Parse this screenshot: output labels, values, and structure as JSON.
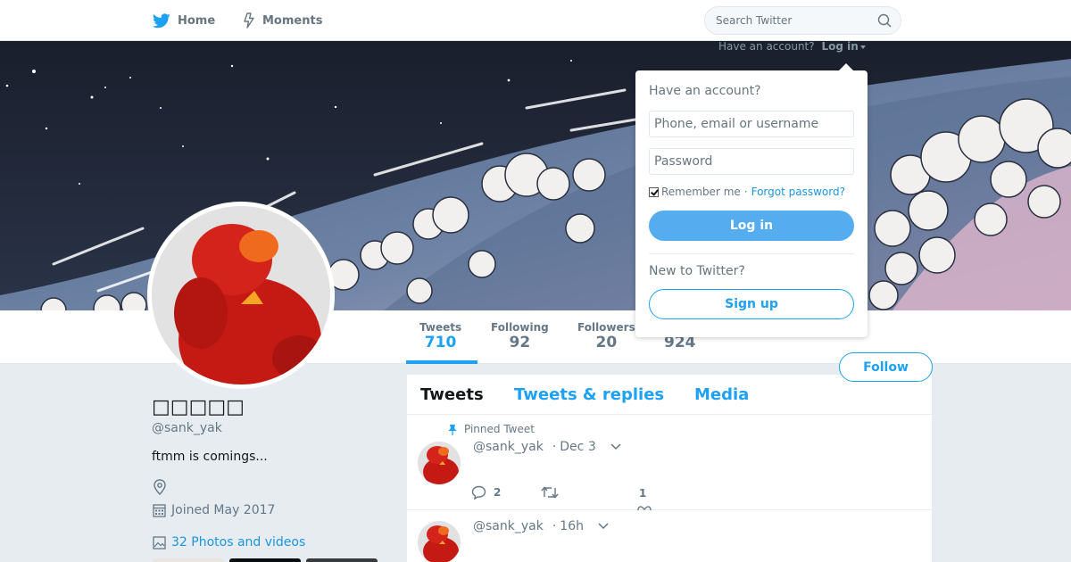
{
  "nav": {
    "home_label": "Home",
    "moments_label": "Moments",
    "search_placeholder": "Search Twitter"
  },
  "login_prompt": {
    "text": "Have an account?",
    "link": "Log in"
  },
  "profile": {
    "display_name": "□□□□□",
    "handle": "@sank_yak",
    "bio": "ftmm is comings...",
    "joined": "Joined May 2017",
    "photos_link": "32 Photos and videos"
  },
  "stats": {
    "tweets_label": "Tweets",
    "tweets_value": "710",
    "following_label": "Following",
    "following_value": "92",
    "followers_label": "Followers",
    "followers_value": "20",
    "likes_value": "924"
  },
  "follow_label": "Follow",
  "timeline": {
    "tabs": [
      "Tweets",
      "Tweets & replies",
      "Media"
    ],
    "tweets": [
      {
        "pinned_label": "Pinned Tweet",
        "handle": "@sank_yak",
        "time": "Dec 3",
        "reply_count": "2",
        "like_count": "1"
      },
      {
        "handle": "@sank_yak",
        "time": "16h"
      }
    ]
  },
  "dropdown": {
    "title": "Have an account?",
    "username_placeholder": "Phone, email or username",
    "password_placeholder": "Password",
    "remember_label": "Remember me",
    "separator": "·",
    "forgot_label": "Forgot password?",
    "login_button": "Log in",
    "new_label": "New to Twitter?",
    "signup_button": "Sign up"
  },
  "colors": {
    "accent": "#1da1f2",
    "link": "#1b95e0",
    "login_button_bg": "#55acee",
    "page_bg": "#e6ecf0",
    "banner_sky": "#1f2535",
    "avatar_red": "#d4231b"
  }
}
